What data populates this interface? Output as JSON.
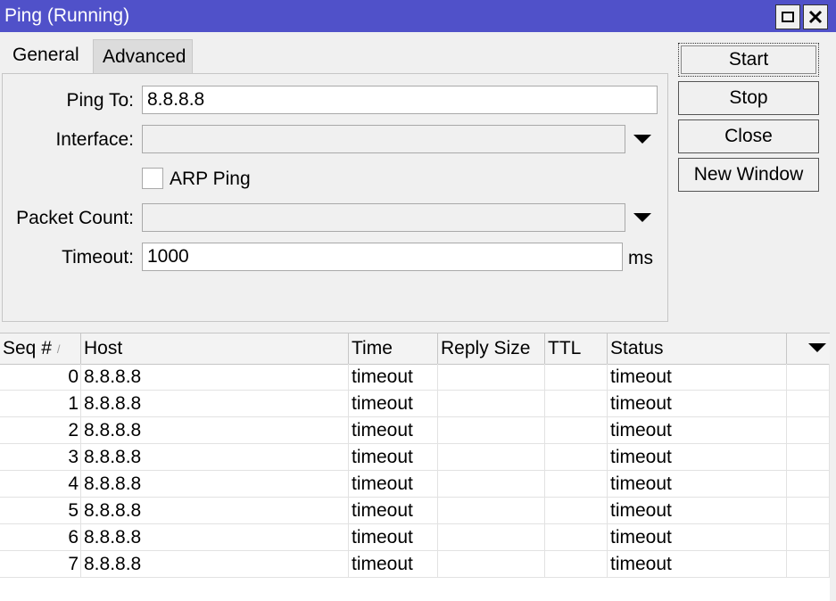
{
  "window": {
    "title": "Ping (Running)"
  },
  "tabs": [
    {
      "label": "General"
    },
    {
      "label": "Advanced"
    }
  ],
  "form": {
    "ping_to_label": "Ping To:",
    "ping_to_value": "8.8.8.8",
    "interface_label": "Interface:",
    "interface_value": "",
    "arp_ping_label": "ARP Ping",
    "arp_ping_checked": false,
    "packet_count_label": "Packet Count:",
    "packet_count_value": "",
    "timeout_label": "Timeout:",
    "timeout_value": "1000",
    "timeout_unit": "ms"
  },
  "buttons": {
    "start": "Start",
    "stop": "Stop",
    "close": "Close",
    "new_window": "New Window"
  },
  "table": {
    "columns": [
      "Seq #",
      "Host",
      "Time",
      "Reply Size",
      "TTL",
      "Status"
    ],
    "sort_indicator": "/",
    "rows": [
      {
        "seq": "0",
        "host": "8.8.8.8",
        "time": "timeout",
        "reply_size": "",
        "ttl": "",
        "status": "timeout"
      },
      {
        "seq": "1",
        "host": "8.8.8.8",
        "time": "timeout",
        "reply_size": "",
        "ttl": "",
        "status": "timeout"
      },
      {
        "seq": "2",
        "host": "8.8.8.8",
        "time": "timeout",
        "reply_size": "",
        "ttl": "",
        "status": "timeout"
      },
      {
        "seq": "3",
        "host": "8.8.8.8",
        "time": "timeout",
        "reply_size": "",
        "ttl": "",
        "status": "timeout"
      },
      {
        "seq": "4",
        "host": "8.8.8.8",
        "time": "timeout",
        "reply_size": "",
        "ttl": "",
        "status": "timeout"
      },
      {
        "seq": "5",
        "host": "8.8.8.8",
        "time": "timeout",
        "reply_size": "",
        "ttl": "",
        "status": "timeout"
      },
      {
        "seq": "6",
        "host": "8.8.8.8",
        "time": "timeout",
        "reply_size": "",
        "ttl": "",
        "status": "timeout"
      },
      {
        "seq": "7",
        "host": "8.8.8.8",
        "time": "timeout",
        "reply_size": "",
        "ttl": "",
        "status": "timeout"
      }
    ]
  },
  "colors": {
    "titlebar": "#5051c9",
    "window_bg": "#f0f0f0",
    "field_bg": "#ffffff"
  },
  "icons": {
    "maximize": "maximize-icon",
    "close": "close-icon",
    "dropdown": "chevron-down-icon",
    "sort": "sort-ascending-icon"
  }
}
